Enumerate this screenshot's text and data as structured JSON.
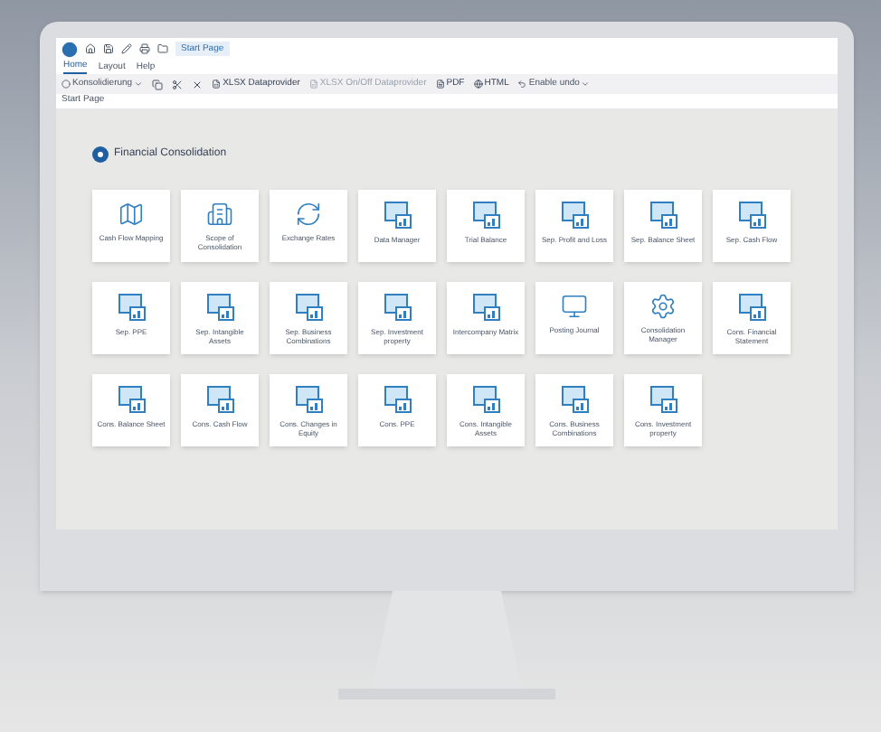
{
  "window": {
    "tab": "Start Page"
  },
  "menu": [
    {
      "label": "Home",
      "selected": true
    },
    {
      "label": "Layout",
      "selected": false
    },
    {
      "label": "Help",
      "selected": false
    }
  ],
  "toolbar": {
    "dropdown": "Konsolidierung",
    "actions": [
      {
        "label": "XLSX Dataprovider",
        "disabled": false
      },
      {
        "label": "XLSX On/Off Dataprovider",
        "disabled": true
      },
      {
        "label": "PDF",
        "disabled": false
      },
      {
        "label": "HTML",
        "disabled": false
      }
    ],
    "undo": "Enable undo"
  },
  "breadcrumb": "Start Page",
  "section": {
    "title": "Financial Consolidation",
    "tiles": [
      {
        "label": "Cash Flow Mapping"
      },
      {
        "label": "Scope of Consolidation"
      },
      {
        "label": "Exchange Rates"
      },
      {
        "label": "Data Manager"
      },
      {
        "label": "Trial Balance"
      },
      {
        "label": "Sep. Profit and Loss"
      },
      {
        "label": "Sep. Balance Sheet"
      },
      {
        "label": "Sep. Cash Flow"
      },
      {
        "label": "Sep. PPE"
      },
      {
        "label": "Sep. Intangible Assets"
      },
      {
        "label": "Sep. Business Combinations"
      },
      {
        "label": "Sep. Investment property"
      },
      {
        "label": "Intercompany Matrix"
      },
      {
        "label": "Posting Journal"
      },
      {
        "label": "Consolidation Manager"
      },
      {
        "label": "Cons. Financial Statement"
      },
      {
        "label": "Cons. Balance Sheet"
      },
      {
        "label": "Cons. Cash Flow"
      },
      {
        "label": "Cons. Changes in Equity"
      },
      {
        "label": "Cons. PPE"
      },
      {
        "label": "Cons. Intangible Assets"
      },
      {
        "label": "Cons. Business Combinations"
      },
      {
        "label": "Cons. Investment property"
      }
    ]
  }
}
